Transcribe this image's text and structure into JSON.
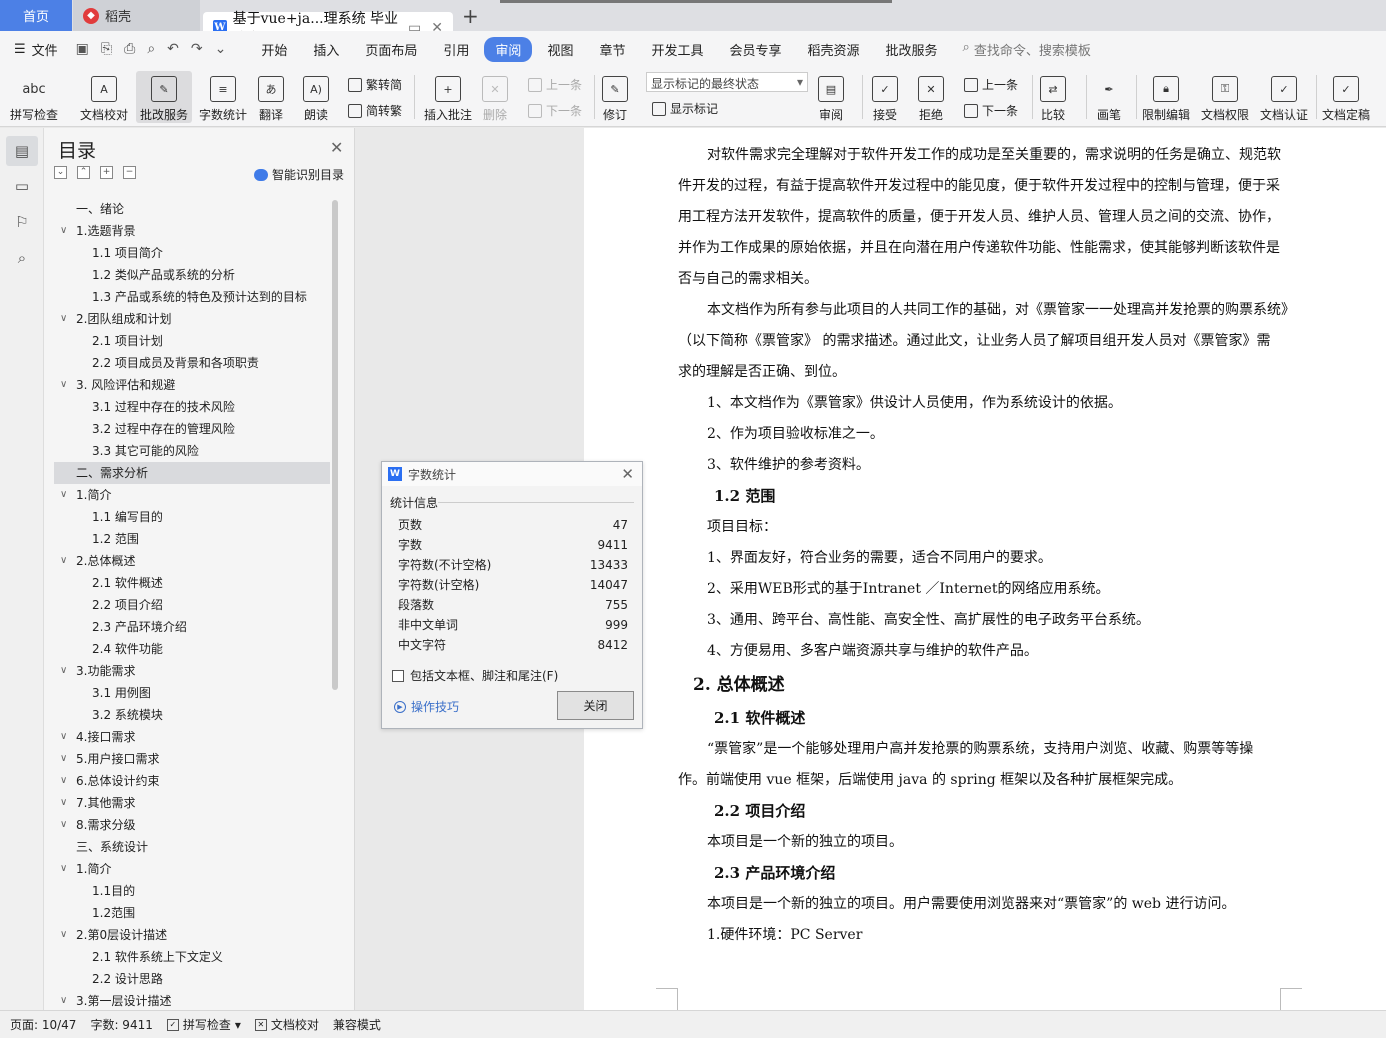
{
  "tabs": {
    "home": "首页",
    "daoke": "稻壳",
    "doc": "基于vue+ja...理系统 毕业论文"
  },
  "menubar": {
    "file": "文件",
    "tabs": [
      "开始",
      "插入",
      "页面布局",
      "引用",
      "审阅",
      "视图",
      "章节",
      "开发工具",
      "会员专享",
      "稻壳资源",
      "批改服务"
    ],
    "active_tab": "审阅",
    "search": "查找命令、搜索模板"
  },
  "ribbon": {
    "spell": "拼写检查",
    "proof": "文档校对",
    "correct": "批改服务",
    "wordcount": "字数统计",
    "translate": "翻译",
    "read": "朗读",
    "to_trad": "繁转简",
    "to_simp": "简转繁",
    "insert_comment": "插入批注",
    "delete": "删除",
    "prev": "上一条",
    "next": "下一条",
    "revise": "修订",
    "markup_select": "显示标记的最终状态",
    "show_markup": "显示标记",
    "review": "审阅",
    "accept": "接受",
    "reject": "拒绝",
    "prev2": "上一条",
    "next2": "下一条",
    "compare": "比较",
    "ink": "画笔",
    "restrict": "限制编辑",
    "permission": "文档权限",
    "certify": "文档认证",
    "finalize": "文档定稿",
    "abc": "abc"
  },
  "toc": {
    "title": "目录",
    "smart": "智能识别目录",
    "items": [
      {
        "text": "一、绪论",
        "level": 1
      },
      {
        "text": "1.选题背景",
        "level": 2
      },
      {
        "text": "1.1 项目简介",
        "level": 3
      },
      {
        "text": "1.2 类似产品或系统的分析",
        "level": 3
      },
      {
        "text": "1.3 产品或系统的特色及预计达到的目标",
        "level": 3
      },
      {
        "text": "2.团队组成和计划",
        "level": 2
      },
      {
        "text": "2.1 项目计划",
        "level": 3
      },
      {
        "text": "2.2 项目成员及背景和各项职责",
        "level": 3
      },
      {
        "text": "3. 风险评估和规避",
        "level": 2
      },
      {
        "text": "3.1 过程中存在的技术风险",
        "level": 3
      },
      {
        "text": "3.2 过程中存在的管理风险",
        "level": 3
      },
      {
        "text": "3.3 其它可能的风险",
        "level": 3
      },
      {
        "text": "二、需求分析",
        "level": 1
      },
      {
        "text": "1.简介",
        "level": 2
      },
      {
        "text": "1.1 编写目的",
        "level": 3
      },
      {
        "text": "1.2 范围",
        "level": 3
      },
      {
        "text": "2.总体概述",
        "level": 2
      },
      {
        "text": "2.1 软件概述",
        "level": 3
      },
      {
        "text": "2.2 项目介绍",
        "level": 3
      },
      {
        "text": "2.3 产品环境介绍",
        "level": 3
      },
      {
        "text": "2.4 软件功能",
        "level": 3
      },
      {
        "text": "3.功能需求",
        "level": 2
      },
      {
        "text": "3.1 用例图",
        "level": 3
      },
      {
        "text": "3.2 系统模块",
        "level": 3
      },
      {
        "text": "4.接口需求",
        "level": 2
      },
      {
        "text": "5.用户接口需求",
        "level": 2
      },
      {
        "text": "6.总体设计约束",
        "level": 2
      },
      {
        "text": "7.其他需求",
        "level": 2
      },
      {
        "text": "8.需求分级",
        "level": 2
      },
      {
        "text": "三、系统设计",
        "level": 1
      },
      {
        "text": "1.简介",
        "level": 2
      },
      {
        "text": "1.1目的",
        "level": 3
      },
      {
        "text": "1.2范围",
        "level": 3
      },
      {
        "text": "2.第0层设计描述",
        "level": 2
      },
      {
        "text": "2.1 软件系统上下文定义",
        "level": 3
      },
      {
        "text": "2.2 设计思路",
        "level": 3
      },
      {
        "text": "3.第一层设计描述",
        "level": 2
      }
    ],
    "selected_index": 12
  },
  "dialog": {
    "title": "字数统计",
    "section": "统计信息",
    "stats": [
      {
        "label": "页数",
        "value": "47"
      },
      {
        "label": "字数",
        "value": "9411"
      },
      {
        "label": "字符数(不计空格)",
        "value": "13433"
      },
      {
        "label": "字符数(计空格)",
        "value": "14047"
      },
      {
        "label": "段落数",
        "value": "755"
      },
      {
        "label": "非中文单词",
        "value": "999"
      },
      {
        "label": "中文字符",
        "value": "8412"
      }
    ],
    "checkbox": "包括文本框、脚注和尾注(F)",
    "tips": "操作技巧",
    "close": "关闭"
  },
  "document": {
    "lines": [
      {
        "t": "对软件需求完全理解对于软件开发工作的成功是至关重要的，需求说明的任务是确立、规范软",
        "k": "ind"
      },
      {
        "t": "件开发的过程，有益于提高软件开发过程中的能见度，便于软件开发过程中的控制与管理，便于采",
        "k": "p"
      },
      {
        "t": "用工程方法开发软件，提高软件的质量，便于开发人员、维护人员、管理人员之间的交流、协作，",
        "k": "p"
      },
      {
        "t": "并作为工作成果的原始依据，并且在向潜在用户传递软件功能、性能需求，使其能够判断该软件是",
        "k": "p"
      },
      {
        "t": "否与自己的需求相关。",
        "k": "p"
      },
      {
        "t": "本文档作为所有参与此项目的人共同工作的基础，对《票管家一一处理高并发抢票的购票系统》",
        "k": "ind"
      },
      {
        "t": "（以下简称《票管家》 的需求描述。通过此文，让业务人员了解项目组开发人员对《票管家》需",
        "k": "p"
      },
      {
        "t": "求的理解是否正确、到位。",
        "k": "p"
      },
      {
        "t": "1、本文档作为《票管家》供设计人员使用，作为系统设计的依据。",
        "k": "ind"
      },
      {
        "t": "2、作为项目验收标准之一。",
        "k": "ind"
      },
      {
        "t": "3、软件维护的参考资料。",
        "k": "ind"
      },
      {
        "t": "1.2 范围",
        "k": "h3"
      },
      {
        "t": "项目目标：",
        "k": "ind"
      },
      {
        "t": "1、界面友好，符合业务的需要，适合不同用户的要求。",
        "k": "ind"
      },
      {
        "t": "2、采用WEB形式的基于Intranet ／Internet的网络应用系统。",
        "k": "ind"
      },
      {
        "t": "3、通用、跨平台、高性能、高安全性、高扩展性的电子政务平台系统。",
        "k": "ind"
      },
      {
        "t": "4、方便易用、多客户端资源共享与维护的软件产品。",
        "k": "ind"
      },
      {
        "t": "2.  总体概述",
        "k": "h2"
      },
      {
        "t": "2.1 软件概述",
        "k": "h3"
      },
      {
        "t": "“票管家”是一个能够处理用户高并发抢票的购票系统，支持用户浏览、收藏、购票等等操",
        "k": "ind"
      },
      {
        "t": "作。前端使用 vue 框架，后端使用 java 的 spring 框架以及各种扩展框架完成。",
        "k": "p"
      },
      {
        "t": "2.2 项目介绍",
        "k": "h3"
      },
      {
        "t": "本项目是一个新的独立的项目。",
        "k": "ind"
      },
      {
        "t": "2.3 产品环境介绍",
        "k": "h3"
      },
      {
        "t": "本项目是一个新的独立的项目。用户需要使用浏览器来对“票管家”的 web 进行访问。",
        "k": "ind"
      },
      {
        "t": "1.硬件环境：PC Server",
        "k": "ind"
      }
    ]
  },
  "statusbar": {
    "page": "页面: 10/47",
    "words": "字数: 9411",
    "spell": "拼写检查",
    "proof": "文档校对",
    "compat": "兼容模式"
  },
  "colors": {
    "accent": "#4c80e6",
    "link": "#3a6fc9"
  }
}
